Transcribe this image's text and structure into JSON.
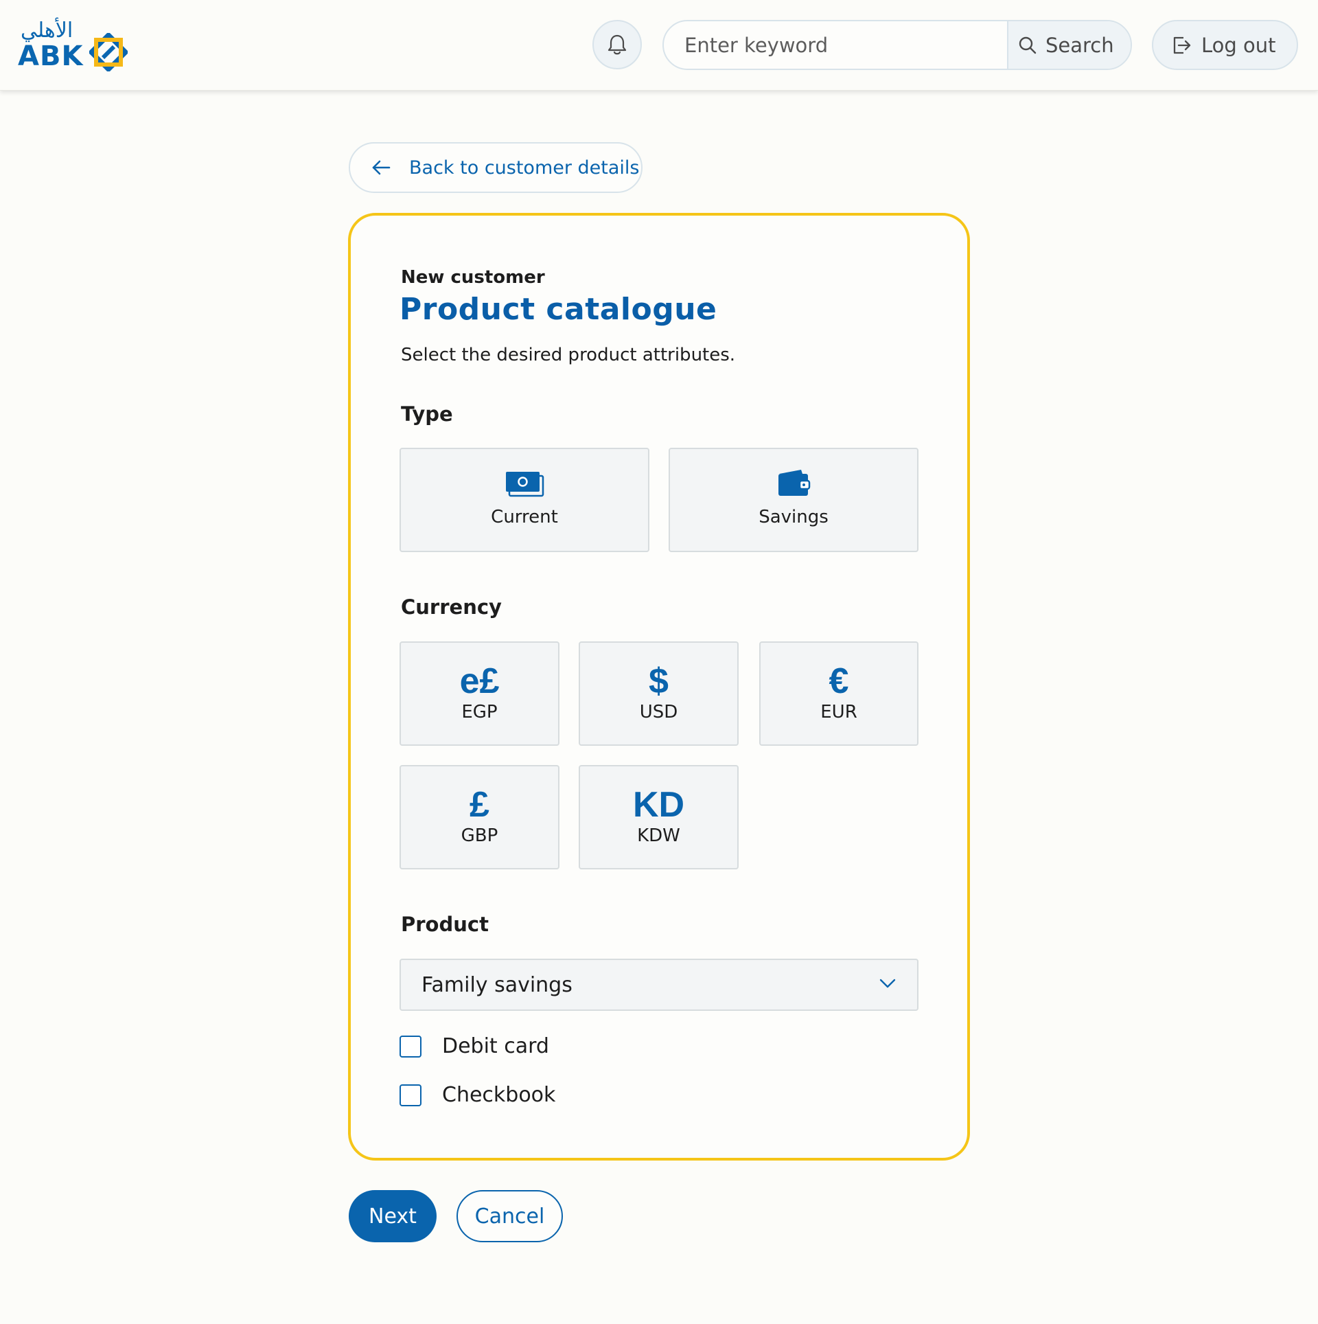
{
  "header": {
    "logo_text": "ABK",
    "logo_arabic": "الأهلي",
    "notifications_icon": "bell-icon",
    "search": {
      "placeholder": "Enter keyword",
      "value": "",
      "button_label": "Search",
      "icon": "search-icon"
    },
    "logout": {
      "label": "Log out",
      "icon": "logout-icon"
    }
  },
  "back_button": {
    "label": "Back to customer details",
    "icon": "arrow-left-icon"
  },
  "card": {
    "eyebrow": "New customer",
    "title": "Product catalogue",
    "subtitle": "Select the desired product attributes.",
    "type": {
      "label": "Type",
      "options": [
        {
          "label": "Current",
          "icon": "cash-icon"
        },
        {
          "label": "Savings",
          "icon": "wallet-icon"
        }
      ]
    },
    "currency": {
      "label": "Currency",
      "options": [
        {
          "symbol": "e£",
          "code": "EGP"
        },
        {
          "symbol": "$",
          "code": "USD"
        },
        {
          "symbol": "€",
          "code": "EUR"
        },
        {
          "symbol": "£",
          "code": "GBP"
        },
        {
          "symbol": "KD",
          "code": "KDW"
        }
      ]
    },
    "product": {
      "label": "Product",
      "selected": "Family savings",
      "extras": [
        {
          "label": "Debit card",
          "checked": false
        },
        {
          "label": "Checkbook",
          "checked": false
        }
      ]
    }
  },
  "actions": {
    "next_label": "Next",
    "cancel_label": "Cancel"
  },
  "colors": {
    "accent_blue": "#0a64ad",
    "card_border_yellow": "#f5c518",
    "background": "#fcfcf9"
  }
}
